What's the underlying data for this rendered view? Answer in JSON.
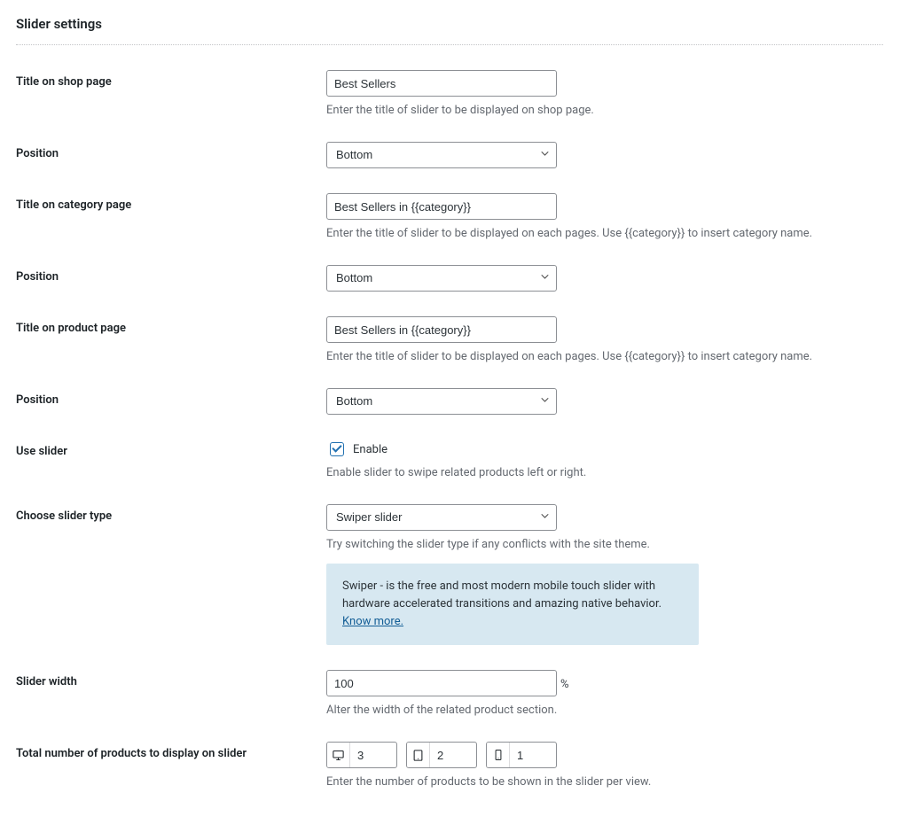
{
  "section_title": "Slider settings",
  "fields": {
    "title_shop": {
      "label": "Title on shop page",
      "value": "Best Sellers",
      "description": "Enter the title of slider to be displayed on shop page."
    },
    "position_shop": {
      "label": "Position",
      "value": "Bottom"
    },
    "title_category": {
      "label": "Title on category page",
      "value": "Best Sellers in {{category}}",
      "description": "Enter the title of slider to be displayed on each pages. Use {{category}} to insert category name."
    },
    "position_category": {
      "label": "Position",
      "value": "Bottom"
    },
    "title_product": {
      "label": "Title on product page",
      "value": "Best Sellers in {{category}}",
      "description": "Enter the title of slider to be displayed on each pages. Use {{category}} to insert category name."
    },
    "position_product": {
      "label": "Position",
      "value": "Bottom"
    },
    "use_slider": {
      "label": "Use slider",
      "checkbox_label": "Enable",
      "description": "Enable slider to swipe related products left or right."
    },
    "slider_type": {
      "label": "Choose slider type",
      "value": "Swiper slider",
      "description": "Try switching the slider type if any conflicts with the site theme.",
      "info_text": "Swiper - is the free and most modern mobile touch slider with hardware accelerated transitions and amazing native behavior. ",
      "info_link": "Know more."
    },
    "slider_width": {
      "label": "Slider width",
      "value": "100",
      "suffix": "%",
      "description": "Alter the width of the related product section."
    },
    "products_count": {
      "label": "Total number of products to display on slider",
      "desktop": "3",
      "tablet": "2",
      "mobile": "1",
      "description": "Enter the number of products to be shown in the slider per view."
    }
  }
}
